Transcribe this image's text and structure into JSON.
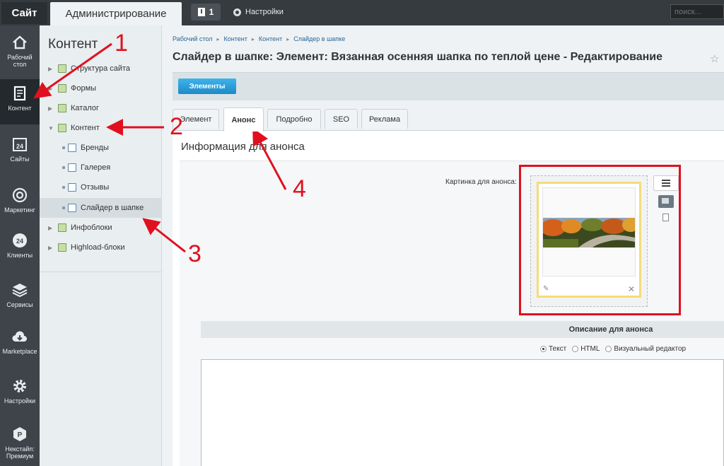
{
  "topbar": {
    "site_label": "Сайт",
    "admin_label": "Администрирование",
    "notifications_count": "1",
    "settings_label": "Настройки",
    "search_placeholder": "поиск..."
  },
  "rail": {
    "items": [
      {
        "label": "Рабочий стол",
        "icon": "home-icon"
      },
      {
        "label": "Контент",
        "icon": "document-icon",
        "active": true
      },
      {
        "label": "Сайты",
        "icon": "calendar-icon"
      },
      {
        "label": "Маркетинг",
        "icon": "target-icon"
      },
      {
        "label": "Клиенты",
        "icon": "clients-icon"
      },
      {
        "label": "Сервисы",
        "icon": "layers-icon"
      },
      {
        "label": "Marketplace",
        "icon": "cloud-icon"
      },
      {
        "label": "Настройки",
        "icon": "gear-icon"
      },
      {
        "label": "Некстайп: Премиум",
        "icon": "brand-icon"
      }
    ]
  },
  "tree": {
    "title": "Контент",
    "items": [
      {
        "label": "Структура сайта"
      },
      {
        "label": "Формы"
      },
      {
        "label": "Каталог"
      },
      {
        "label": "Контент"
      },
      {
        "label": "Бренды"
      },
      {
        "label": "Галерея"
      },
      {
        "label": "Отзывы"
      },
      {
        "label": "Слайдер в шапке"
      },
      {
        "label": "Инфоблоки"
      },
      {
        "label": "Highload-блоки"
      }
    ]
  },
  "breadcrumbs": [
    "Рабочий стол",
    "Контент",
    "Контент",
    "Слайдер в шапке"
  ],
  "page_title": "Слайдер в шапке: Элемент: Вязанная осенняя шапка по теплой цене - Редактирование",
  "toolbar": {
    "elements_label": "Элементы"
  },
  "tabs": [
    {
      "label": "Элемент"
    },
    {
      "label": "Анонс",
      "active": true
    },
    {
      "label": "Подробно"
    },
    {
      "label": "SEO"
    },
    {
      "label": "Реклама"
    }
  ],
  "section": {
    "title": "Информация для анонса",
    "picture_label": "Картинка для анонса:",
    "description_header": "Описание для анонса",
    "radio_options": [
      {
        "label": "Текст",
        "checked": true
      },
      {
        "label": "HTML",
        "checked": false
      },
      {
        "label": "Визуальный редактор",
        "checked": false
      }
    ]
  },
  "annotations": [
    "1",
    "2",
    "3",
    "4"
  ],
  "colors": {
    "annotation": "#e0101f",
    "accent": "#2d9bd6",
    "rail": "#3e4449"
  }
}
